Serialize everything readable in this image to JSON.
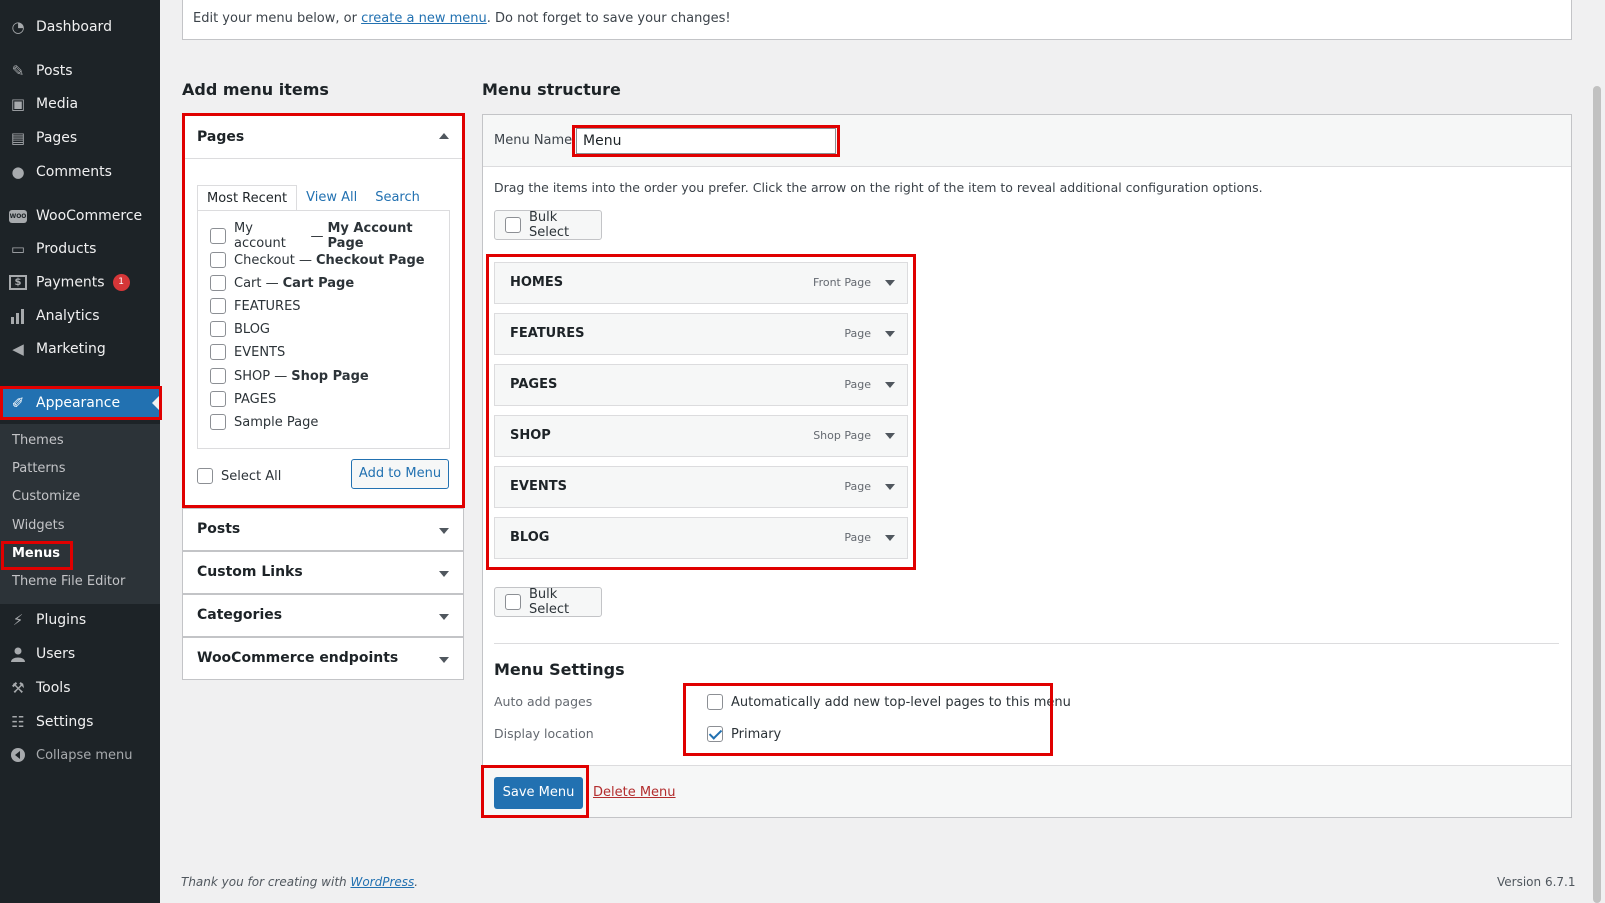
{
  "sidebar": {
    "items": [
      {
        "label": "Dashboard",
        "icon": "dashboard-icon"
      },
      {
        "label": "Posts",
        "icon": "pin-icon"
      },
      {
        "label": "Media",
        "icon": "media-icon"
      },
      {
        "label": "Pages",
        "icon": "pages-icon"
      },
      {
        "label": "Comments",
        "icon": "comment-icon"
      },
      {
        "label": "WooCommerce",
        "icon": "woo-icon"
      },
      {
        "label": "Products",
        "icon": "archive-icon"
      },
      {
        "label": "Payments",
        "icon": "dollar-icon",
        "badge": "1"
      },
      {
        "label": "Analytics",
        "icon": "bar-chart-icon"
      },
      {
        "label": "Marketing",
        "icon": "megaphone-icon"
      },
      {
        "label": "Appearance",
        "icon": "brush-icon"
      },
      {
        "label": "Plugins",
        "icon": "plug-icon"
      },
      {
        "label": "Users",
        "icon": "user-icon"
      },
      {
        "label": "Tools",
        "icon": "wrench-icon"
      },
      {
        "label": "Settings",
        "icon": "settings-icon"
      },
      {
        "label": "Collapse menu",
        "icon": "collapse-icon"
      }
    ],
    "submenu": [
      "Themes",
      "Patterns",
      "Customize",
      "Widgets",
      "Menus",
      "Theme File Editor"
    ],
    "current_submenu": "Menus"
  },
  "notice": {
    "text_before": "Edit your menu below, or ",
    "link": "create a new menu",
    "text_after": ". Do not forget to save your changes!"
  },
  "add_items": {
    "title": "Add menu items",
    "pages_panel": {
      "title": "Pages",
      "tabs": [
        "Most Recent",
        "View All",
        "Search"
      ],
      "pages": [
        {
          "name": "My account",
          "sep": "—",
          "note": "My Account Page"
        },
        {
          "name": "Checkout",
          "sep": "—",
          "note": "Checkout Page"
        },
        {
          "name": "Cart",
          "sep": "—",
          "note": "Cart Page"
        },
        {
          "name": "FEATURES",
          "sep": "",
          "note": ""
        },
        {
          "name": "BLOG",
          "sep": "",
          "note": ""
        },
        {
          "name": "EVENTS",
          "sep": "",
          "note": ""
        },
        {
          "name": "SHOP",
          "sep": "—",
          "note": "Shop Page"
        },
        {
          "name": "PAGES",
          "sep": "",
          "note": ""
        },
        {
          "name": "Sample Page",
          "sep": "",
          "note": ""
        }
      ],
      "select_all": "Select All",
      "add_button": "Add to Menu"
    },
    "panels": [
      "Posts",
      "Custom Links",
      "Categories",
      "WooCommerce endpoints"
    ]
  },
  "structure": {
    "title": "Menu structure",
    "menu_name_label": "Menu Name",
    "menu_name_value": "Menu",
    "instructions": "Drag the items into the order you prefer. Click the arrow on the right of the item to reveal additional configuration options.",
    "bulk_select": "Bulk Select",
    "items": [
      {
        "title": "HOMES",
        "type": "Front Page"
      },
      {
        "title": "FEATURES",
        "type": "Page"
      },
      {
        "title": "PAGES",
        "type": "Page"
      },
      {
        "title": "SHOP",
        "type": "Shop Page"
      },
      {
        "title": "EVENTS",
        "type": "Page"
      },
      {
        "title": "BLOG",
        "type": "Page"
      }
    ],
    "settings": {
      "title": "Menu Settings",
      "auto_add_label": "Auto add pages",
      "auto_add_text": "Automatically add new top-level pages to this menu",
      "auto_add_checked": false,
      "location_label": "Display location",
      "location_text": "Primary",
      "location_checked": true
    },
    "save_button": "Save Menu",
    "delete_link": "Delete Menu"
  },
  "footer": {
    "thanks_before": "Thank you for creating with ",
    "thanks_link": "WordPress",
    "thanks_after": ".",
    "version": "Version 6.7.1"
  },
  "colors": {
    "sidebar_bg": "#1d2327",
    "accent": "#2271b1",
    "highlight_box": "#e00000",
    "badge": "#d63638"
  }
}
